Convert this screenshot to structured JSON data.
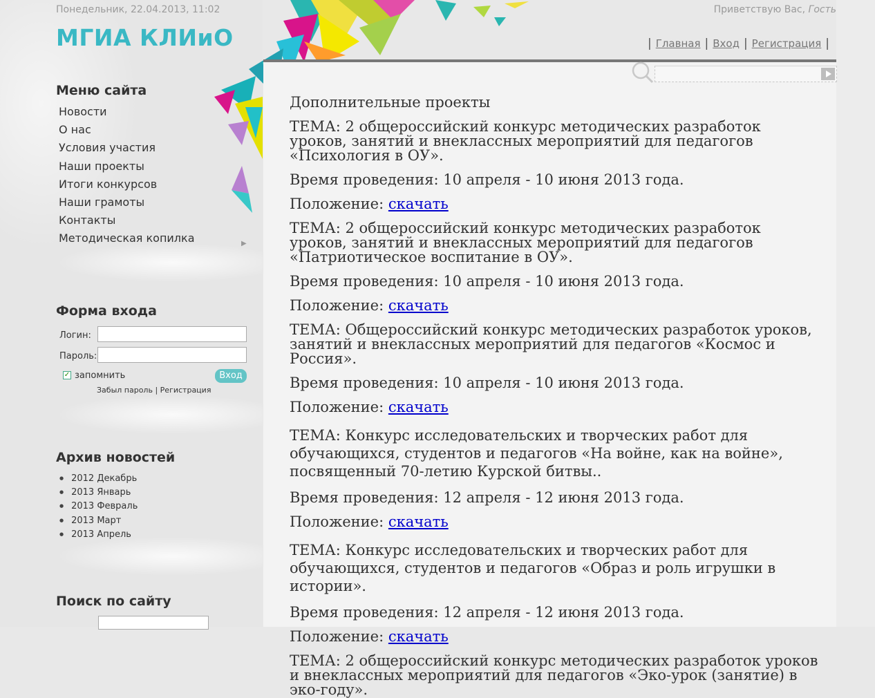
{
  "header": {
    "date": "Понедельник, 22.04.2013, 11:02",
    "greeting": "Приветствую Вас,",
    "user": "Гость",
    "logo": "МГИА КЛИиО",
    "nav": [
      "Главная",
      "Вход",
      "Регистрация"
    ]
  },
  "sidebar": {
    "menu_title": "Меню сайта",
    "menu": [
      "Новости",
      "О нас",
      "Условия участия",
      "Наши проекты",
      "Итоги конкурсов",
      "Наши грамоты",
      "Контакты",
      "Методическая копилка"
    ],
    "login_title": "Форма входа",
    "login_label": "Логин:",
    "password_label": "Пароль:",
    "remember_label": "запомнить",
    "login_button": "Вход",
    "forgot_label": "Забыл пароль",
    "links_sep": "|",
    "register_label": "Регистрация",
    "archive_title": "Архив новостей",
    "archive": [
      "2012 Декабрь",
      "2013 Январь",
      "2013 Февраль",
      "2013 Март",
      "2013 Апрель"
    ],
    "search_title": "Поиск по сайту"
  },
  "article": {
    "title": "Дополнительные проекты",
    "time_label": "Время проведения:",
    "position_label": "Положение:",
    "download_label": "скачать",
    "items": [
      {
        "theme": "ТЕМА: 2 общероссийский конкурс методических разработок уроков, занятий и внеклассных мероприятий для педагогов «Психология в ОУ».",
        "time": "10 апреля - 10 июня 2013 года."
      },
      {
        "theme": "ТЕМА: 2 общероссийский конкурс методических разработок уроков, занятий и внеклассных мероприятий для педагогов «Патриотическое воспитание в ОУ».",
        "time": "10 апреля - 10 июня 2013 года."
      },
      {
        "theme": "ТЕМА: Общероссийский конкурс методических разработок уроков, занятий и внеклассных мероприятий для педагогов «Космос и Россия».",
        "time": "10 апреля - 10 июня 2013 года."
      },
      {
        "theme": "ТЕМА: Конкурс исследовательских и творческих работ для обучающихся, студентов и педагогов «На войне, как на войне», посвященный 70-летию Курской битвы..",
        "time": "12 апреля - 12 июня 2013 года."
      },
      {
        "theme": "ТЕМА: Конкурс исследовательских и творческих работ для обучающихся, студентов и педагогов «Образ и роль игрушки в истории».",
        "time": "12 апреля - 12 июня 2013 года."
      },
      {
        "theme": "ТЕМА: 2 общероссийский конкурс методических разработок уроков и внеклассных мероприятий для педагогов «Эко-урок (занятие) в эко-году».",
        "time": ""
      }
    ]
  },
  "colors": {
    "accent": "#3ab8c4",
    "button": "#63c4c6",
    "link": "#0000cc"
  }
}
